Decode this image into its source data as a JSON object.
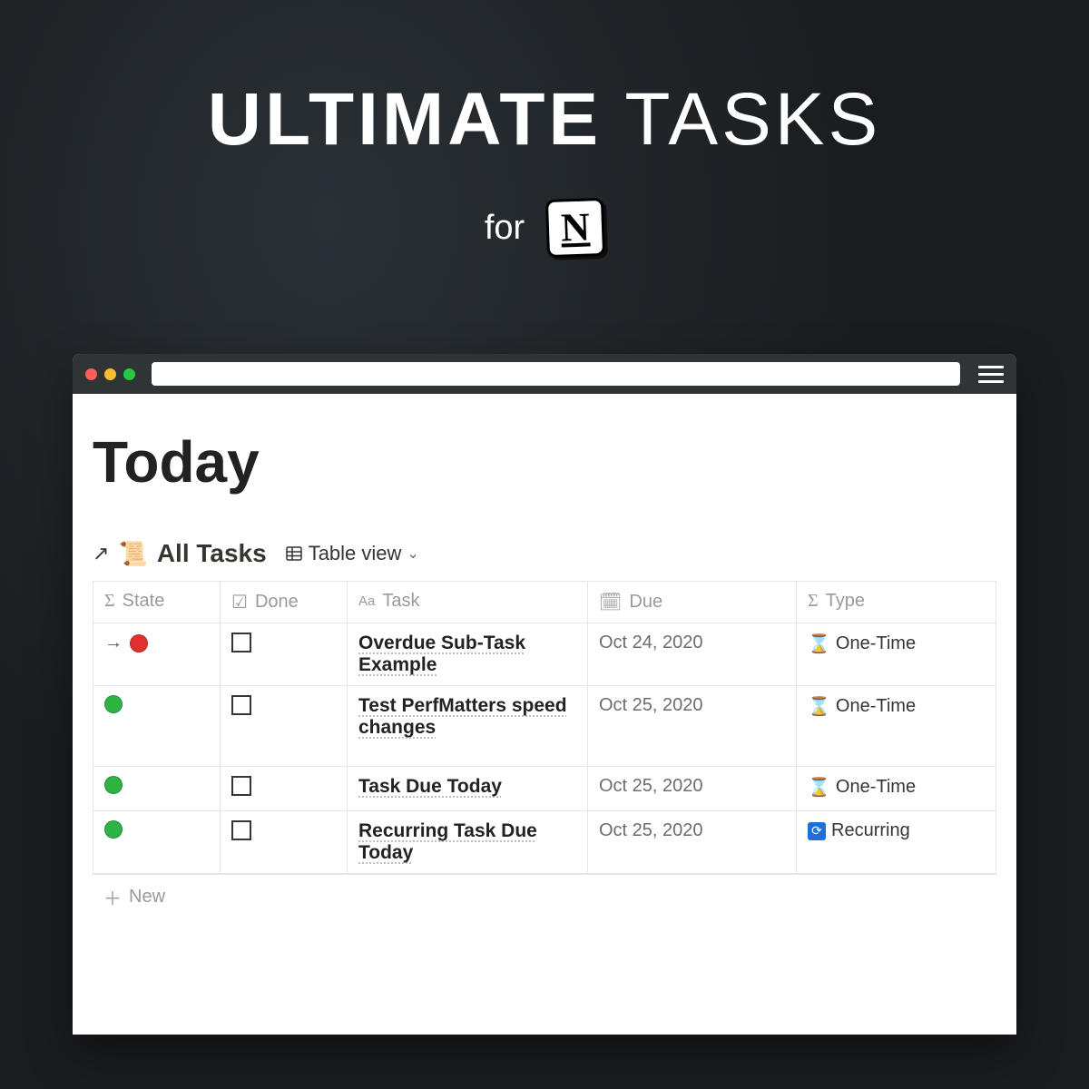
{
  "hero": {
    "title_bold": "ULTIMATE",
    "title_light": "TASKS",
    "for_label": "for",
    "logo_letter": "N"
  },
  "page": {
    "title": "Today",
    "link_source": "All Tasks",
    "view_label": "Table view"
  },
  "columns": {
    "state": "State",
    "done": "Done",
    "task": "Task",
    "due": "Due",
    "type": "Type"
  },
  "rows": [
    {
      "state_color": "red",
      "is_subtask": true,
      "done": false,
      "task": "Overdue Sub-Task Example",
      "due": "Oct 24, 2020",
      "type_icon": "hourglass",
      "type_label": "One-Time"
    },
    {
      "state_color": "green",
      "is_subtask": false,
      "done": false,
      "task": "Test PerfMatters speed changes",
      "due": "Oct 25, 2020",
      "type_icon": "hourglass",
      "type_label": "One-Time"
    },
    {
      "state_color": "green",
      "is_subtask": false,
      "done": false,
      "task": "Task Due Today",
      "due": "Oct 25, 2020",
      "type_icon": "hourglass",
      "type_label": "One-Time"
    },
    {
      "state_color": "green",
      "is_subtask": false,
      "done": false,
      "task": "Recurring Task Due Today",
      "due": "Oct 25, 2020",
      "type_icon": "recurring",
      "type_label": "Recurring"
    }
  ],
  "new_row_label": "New"
}
